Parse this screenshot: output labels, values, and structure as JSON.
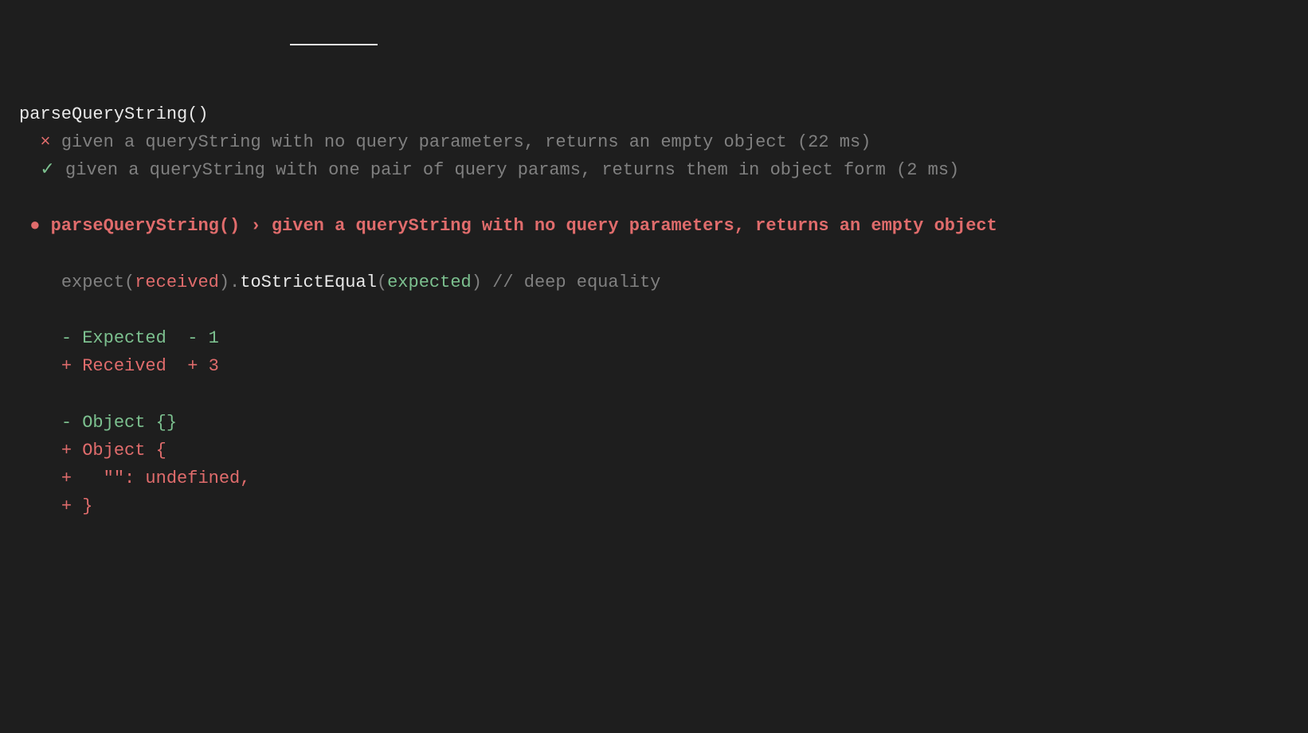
{
  "suite": {
    "name": "parseQueryString()"
  },
  "tests": [
    {
      "mark": "×",
      "status": "fail",
      "text": "given a queryString with no query parameters, returns an empty object (22 ms)"
    },
    {
      "mark": "✓",
      "status": "pass",
      "text": "given a queryString with one pair of query params, returns them in object form (2 ms)"
    }
  ],
  "error": {
    "bullet": "●",
    "header": "parseQueryString() › given a queryString with no query parameters, returns an empty object",
    "assertion": {
      "expect": "expect(",
      "received": "received",
      "dot": ").",
      "matcher": "toStrictEqual",
      "parenOpen": "(",
      "expected": "expected",
      "parenClose": ")",
      "comment": "// deep equality"
    },
    "diff": {
      "expectedLine": "- Expected  - 1",
      "receivedLine": "+ Received  + 3",
      "lines": [
        "- Object {}",
        "+ Object {",
        "+   \"\": undefined,",
        "+ }"
      ]
    }
  },
  "colors": {
    "background": "#1e1e1e",
    "default": "#cccccc",
    "muted": "#808080",
    "fail": "#e06c6c",
    "pass": "#7cc08f",
    "bright": "#e8e8e8"
  }
}
